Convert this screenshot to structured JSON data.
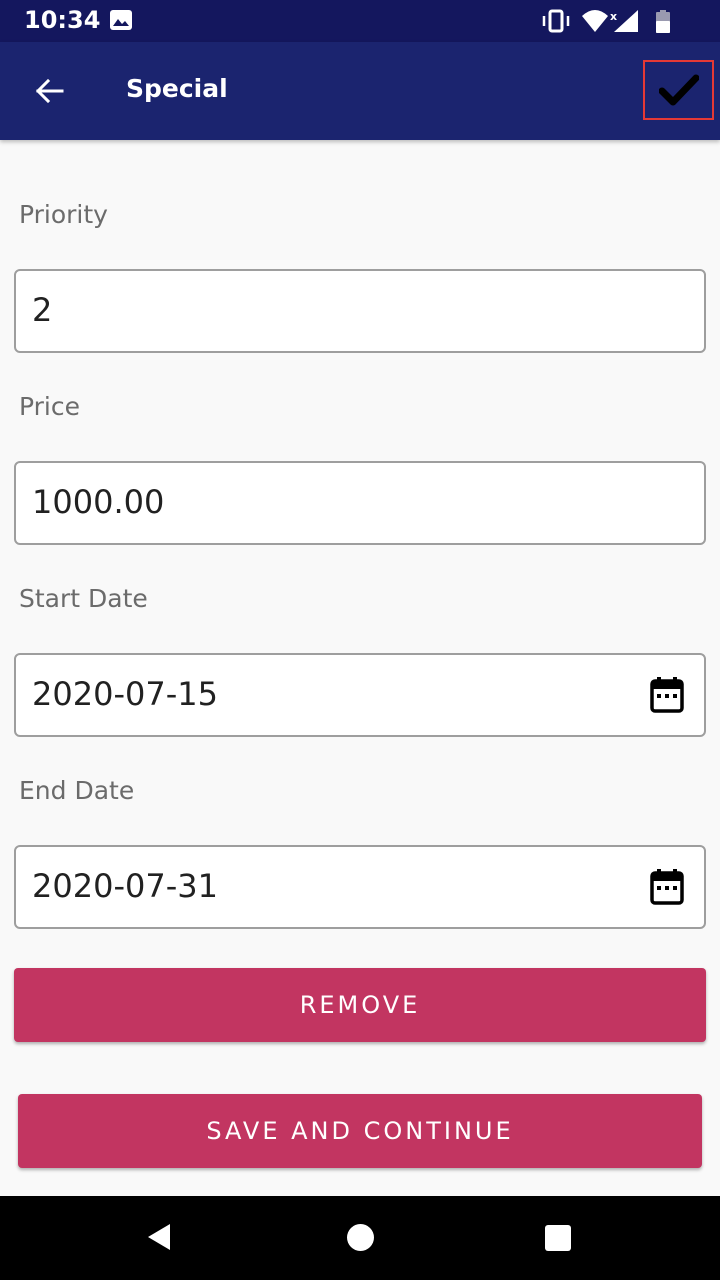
{
  "status_bar": {
    "time": "10:34"
  },
  "app_bar": {
    "title": "Special"
  },
  "fields": {
    "priority": {
      "label": "Priority",
      "value": "2"
    },
    "price": {
      "label": "Price",
      "value": "1000.00"
    },
    "start_date": {
      "label": "Start Date",
      "value": "2020-07-15"
    },
    "end_date": {
      "label": "End Date",
      "value": "2020-07-31"
    }
  },
  "buttons": {
    "remove": "REMOVE",
    "save": "SAVE AND CONTINUE"
  },
  "colors": {
    "status_bar": "#14175e",
    "app_bar": "#1b246f",
    "accent": "#c23561",
    "highlight": "#e53935"
  },
  "icons": [
    "image-icon",
    "vibrate-icon",
    "wifi-icon",
    "no-signal-icon",
    "battery-icon",
    "back-arrow-icon",
    "check-icon",
    "calendar-icon",
    "nav-back-icon",
    "nav-home-icon",
    "nav-recent-icon"
  ]
}
